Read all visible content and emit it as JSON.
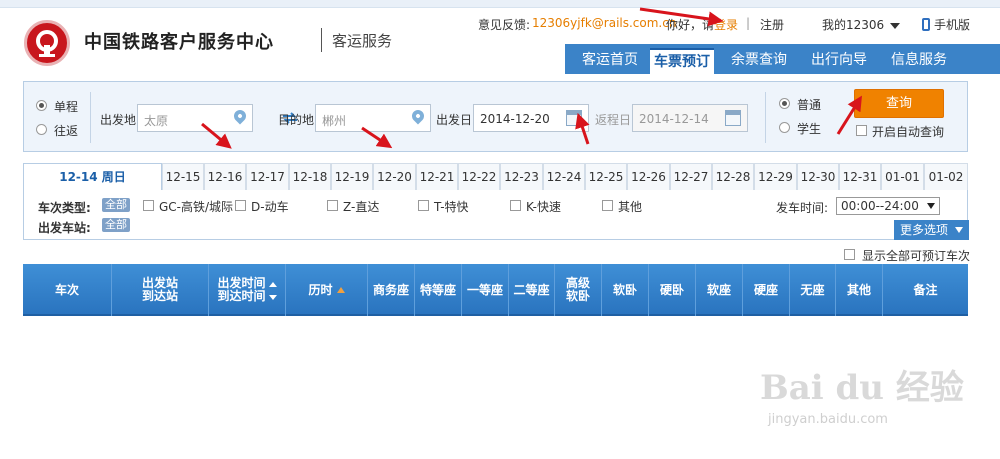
{
  "header": {
    "brand": "中国铁路客户服务中心",
    "subtitle": "客运服务",
    "feedback_label": "意见反馈:",
    "feedback_email": "12306yjfk@rails.com.cn",
    "greeting": "你好，请",
    "login": "登录",
    "register": "注册",
    "my12306": "我的12306",
    "mobile": "手机版"
  },
  "nav": {
    "items": [
      {
        "label": "客运首页"
      },
      {
        "label": "车票预订"
      },
      {
        "label": "余票查询"
      },
      {
        "label": "出行向导"
      },
      {
        "label": "信息服务"
      }
    ],
    "active": "车票预订"
  },
  "search": {
    "oneway": "单程",
    "roundtrip": "往返",
    "from_label": "出发地",
    "from_value": "太原",
    "to_label": "目的地",
    "to_value": "郴州",
    "date_label": "出发日",
    "date_value": "2014-12-20",
    "return_label": "返程日",
    "return_value": "2014-12-14",
    "type_normal": "普通",
    "type_student": "学生",
    "query_button": "查询",
    "auto_query": "开启自动查询"
  },
  "dates": {
    "tabs": [
      "12-14 周日",
      "12-15",
      "12-16",
      "12-17",
      "12-18",
      "12-19",
      "12-20",
      "12-21",
      "12-22",
      "12-23",
      "12-24",
      "12-25",
      "12-26",
      "12-27",
      "12-28",
      "12-29",
      "12-30",
      "12-31",
      "01-01",
      "01-02"
    ]
  },
  "filters": {
    "train_type_label": "车次类型:",
    "station_label": "出发车站:",
    "all_tag": "全部",
    "options": [
      "GC-高铁/城际",
      "D-动车",
      "Z-直达",
      "T-特快",
      "K-快速",
      "其他"
    ],
    "depart_time_label": "发车时间:",
    "depart_time_value": "00:00--24:00",
    "more_options": "更多选项",
    "show_all_bookable": "显示全部可预订车次"
  },
  "table": {
    "headers": [
      "车次",
      "出发站 到达站",
      "出发时间 到达时间",
      "历时",
      "商务座",
      "特等座",
      "一等座",
      "二等座",
      "高级 软卧",
      "软卧",
      "硬卧",
      "软座",
      "硬座",
      "无座",
      "其他",
      "备注"
    ],
    "h_train": "车次",
    "h_station_1": "出发站",
    "h_station_2": "到达站",
    "h_time_1": "出发时间",
    "h_time_2": "到达时间",
    "h_duration": "历时",
    "h_seats": [
      "商务座",
      "特等座",
      "一等座",
      "二等座"
    ],
    "h_gjrw_1": "高级",
    "h_gjrw_2": "软卧",
    "h_rest": [
      "软卧",
      "硬卧",
      "软座",
      "硬座",
      "无座",
      "其他"
    ],
    "h_note": "备注"
  },
  "watermark": {
    "logo": "Bai du 经验",
    "url": "jingyan.baidu.com"
  },
  "colors": {
    "primary_blue": "#3b83c8",
    "query_orange": "#f08200",
    "link_orange": "#e67e00",
    "brand_red": "#c8161d",
    "annotation_red": "#d8141c"
  }
}
